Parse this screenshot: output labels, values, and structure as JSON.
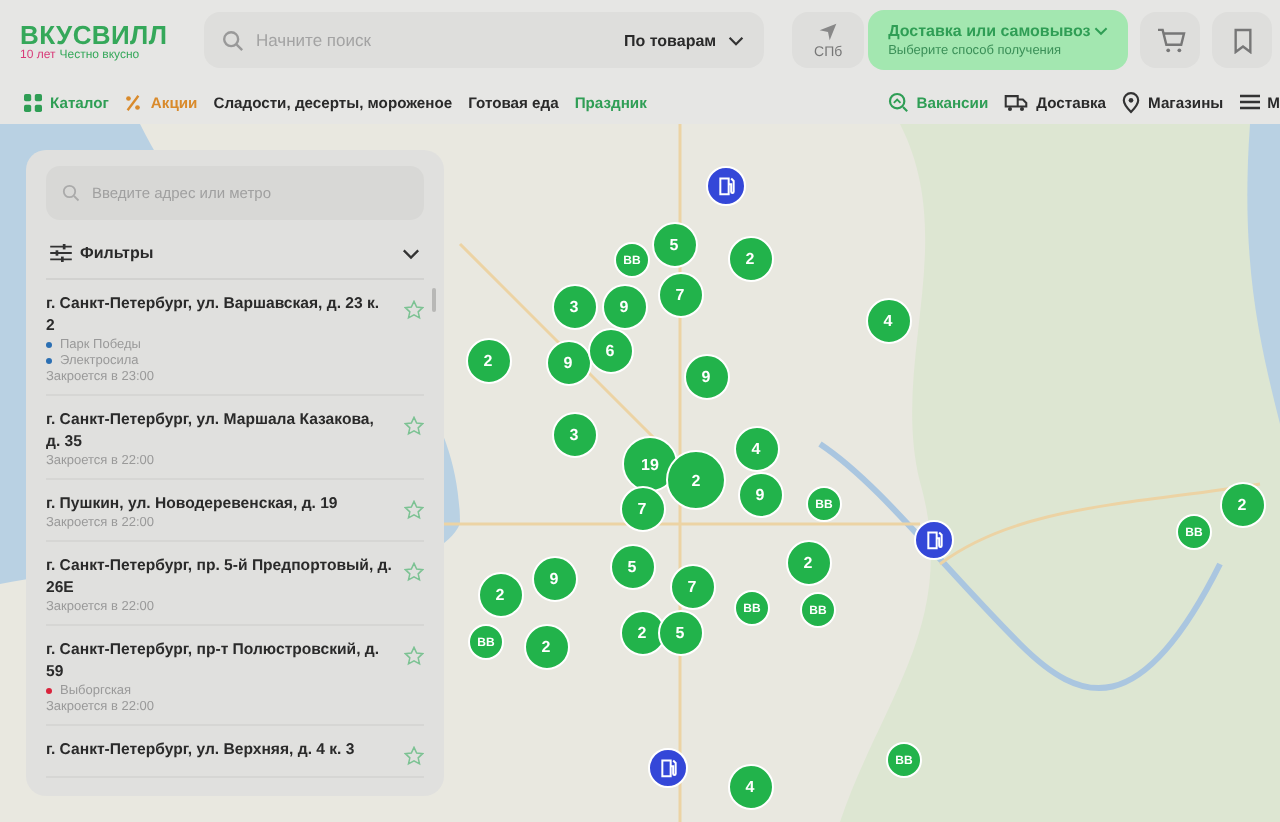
{
  "header": {
    "logo": {
      "name": "ВКУСВИЛЛ",
      "anniversary": "10 лет",
      "slogan": "Честно вкусно"
    },
    "search": {
      "placeholder": "Начните поиск",
      "scope": "По товарам"
    },
    "location": "СПб",
    "delivery": {
      "title": "Доставка или самовывоз",
      "subtitle": "Выберите способ получения"
    }
  },
  "nav": {
    "items": [
      {
        "label": "Каталог",
        "kind": "catalog"
      },
      {
        "label": "Акции",
        "kind": "promo"
      },
      {
        "label": "Сладости, десерты, мороженое",
        "kind": "plain"
      },
      {
        "label": "Готовая еда",
        "kind": "plain"
      },
      {
        "label": "Праздник",
        "kind": "highlight"
      }
    ],
    "right_items": [
      {
        "label": "Вакансии",
        "kind": "jobs"
      },
      {
        "label": "Доставка",
        "kind": "delivery"
      },
      {
        "label": "Магазины",
        "kind": "stores"
      },
      {
        "label": "М",
        "kind": "menu"
      }
    ]
  },
  "store_panel": {
    "search": {
      "placeholder": "Введите адрес или метро"
    },
    "filters": {
      "label": "Фильтры",
      "expanded": false
    },
    "stores": [
      {
        "address": "г. Санкт-Петербург, ул. Варшавская, д. 23 к. 2",
        "metro": [
          {
            "name": "Парк Победы",
            "color": "#2b6fb3"
          },
          {
            "name": "Электросила",
            "color": "#2b6fb3"
          }
        ],
        "hours": "Закроется в 23:00",
        "favorite": false
      },
      {
        "address": "г. Санкт-Петербург, ул. Маршала Казакова, д. 35",
        "hours": "Закроется в 22:00",
        "favorite": false
      },
      {
        "address": "г. Пушкин, ул. Новодеревенская, д. 19",
        "hours": "Закроется в 22:00",
        "favorite": false
      },
      {
        "address": "г. Санкт-Петербург, пр. 5-й Предпортовый, д. 26Е",
        "hours": "Закроется в 22:00",
        "favorite": false
      },
      {
        "address": "г. Санкт-Петербург, пр-т Полюстровский, д. 59",
        "metro": [
          {
            "name": "Выборгская",
            "color": "#d9243c"
          }
        ],
        "hours": "Закроется в 22:00",
        "favorite": false
      },
      {
        "address": "г. Санкт-Петербург, ул. Верхняя, д. 4 к. 3",
        "favorite": false
      }
    ]
  },
  "map": {
    "markers": [
      {
        "kind": "fuel"
      },
      {
        "kind": "cluster",
        "label": "5"
      },
      {
        "kind": "store",
        "label": "ВВ"
      },
      {
        "kind": "cluster",
        "label": "2"
      },
      {
        "kind": "cluster",
        "label": "7"
      },
      {
        "kind": "cluster",
        "label": "3"
      },
      {
        "kind": "cluster",
        "label": "9"
      },
      {
        "kind": "cluster",
        "label": "4"
      },
      {
        "kind": "cluster",
        "label": "2"
      },
      {
        "kind": "cluster",
        "label": "9"
      },
      {
        "kind": "cluster",
        "label": "6"
      },
      {
        "kind": "cluster",
        "label": "9"
      },
      {
        "kind": "cluster",
        "label": "3"
      },
      {
        "kind": "cluster",
        "label": "4"
      },
      {
        "kind": "cluster",
        "label": "19"
      },
      {
        "kind": "cluster",
        "label": "2"
      },
      {
        "kind": "cluster",
        "label": "9"
      },
      {
        "kind": "store",
        "label": "ВВ"
      },
      {
        "kind": "cluster",
        "label": "7"
      },
      {
        "kind": "fuel"
      },
      {
        "kind": "cluster",
        "label": "2"
      },
      {
        "kind": "store",
        "label": "ВВ"
      },
      {
        "kind": "cluster",
        "label": "5"
      },
      {
        "kind": "cluster",
        "label": "9"
      },
      {
        "kind": "cluster",
        "label": "2"
      },
      {
        "kind": "cluster",
        "label": "2"
      },
      {
        "kind": "cluster",
        "label": "7"
      },
      {
        "kind": "store",
        "label": "ВВ"
      },
      {
        "kind": "store",
        "label": "ВВ"
      },
      {
        "kind": "store",
        "label": "ВВ"
      },
      {
        "kind": "cluster",
        "label": "2"
      },
      {
        "kind": "cluster",
        "label": "2"
      },
      {
        "kind": "cluster",
        "label": "5"
      },
      {
        "kind": "fuel"
      },
      {
        "kind": "cluster",
        "label": "4"
      },
      {
        "kind": "store",
        "label": "ВВ"
      }
    ]
  }
}
